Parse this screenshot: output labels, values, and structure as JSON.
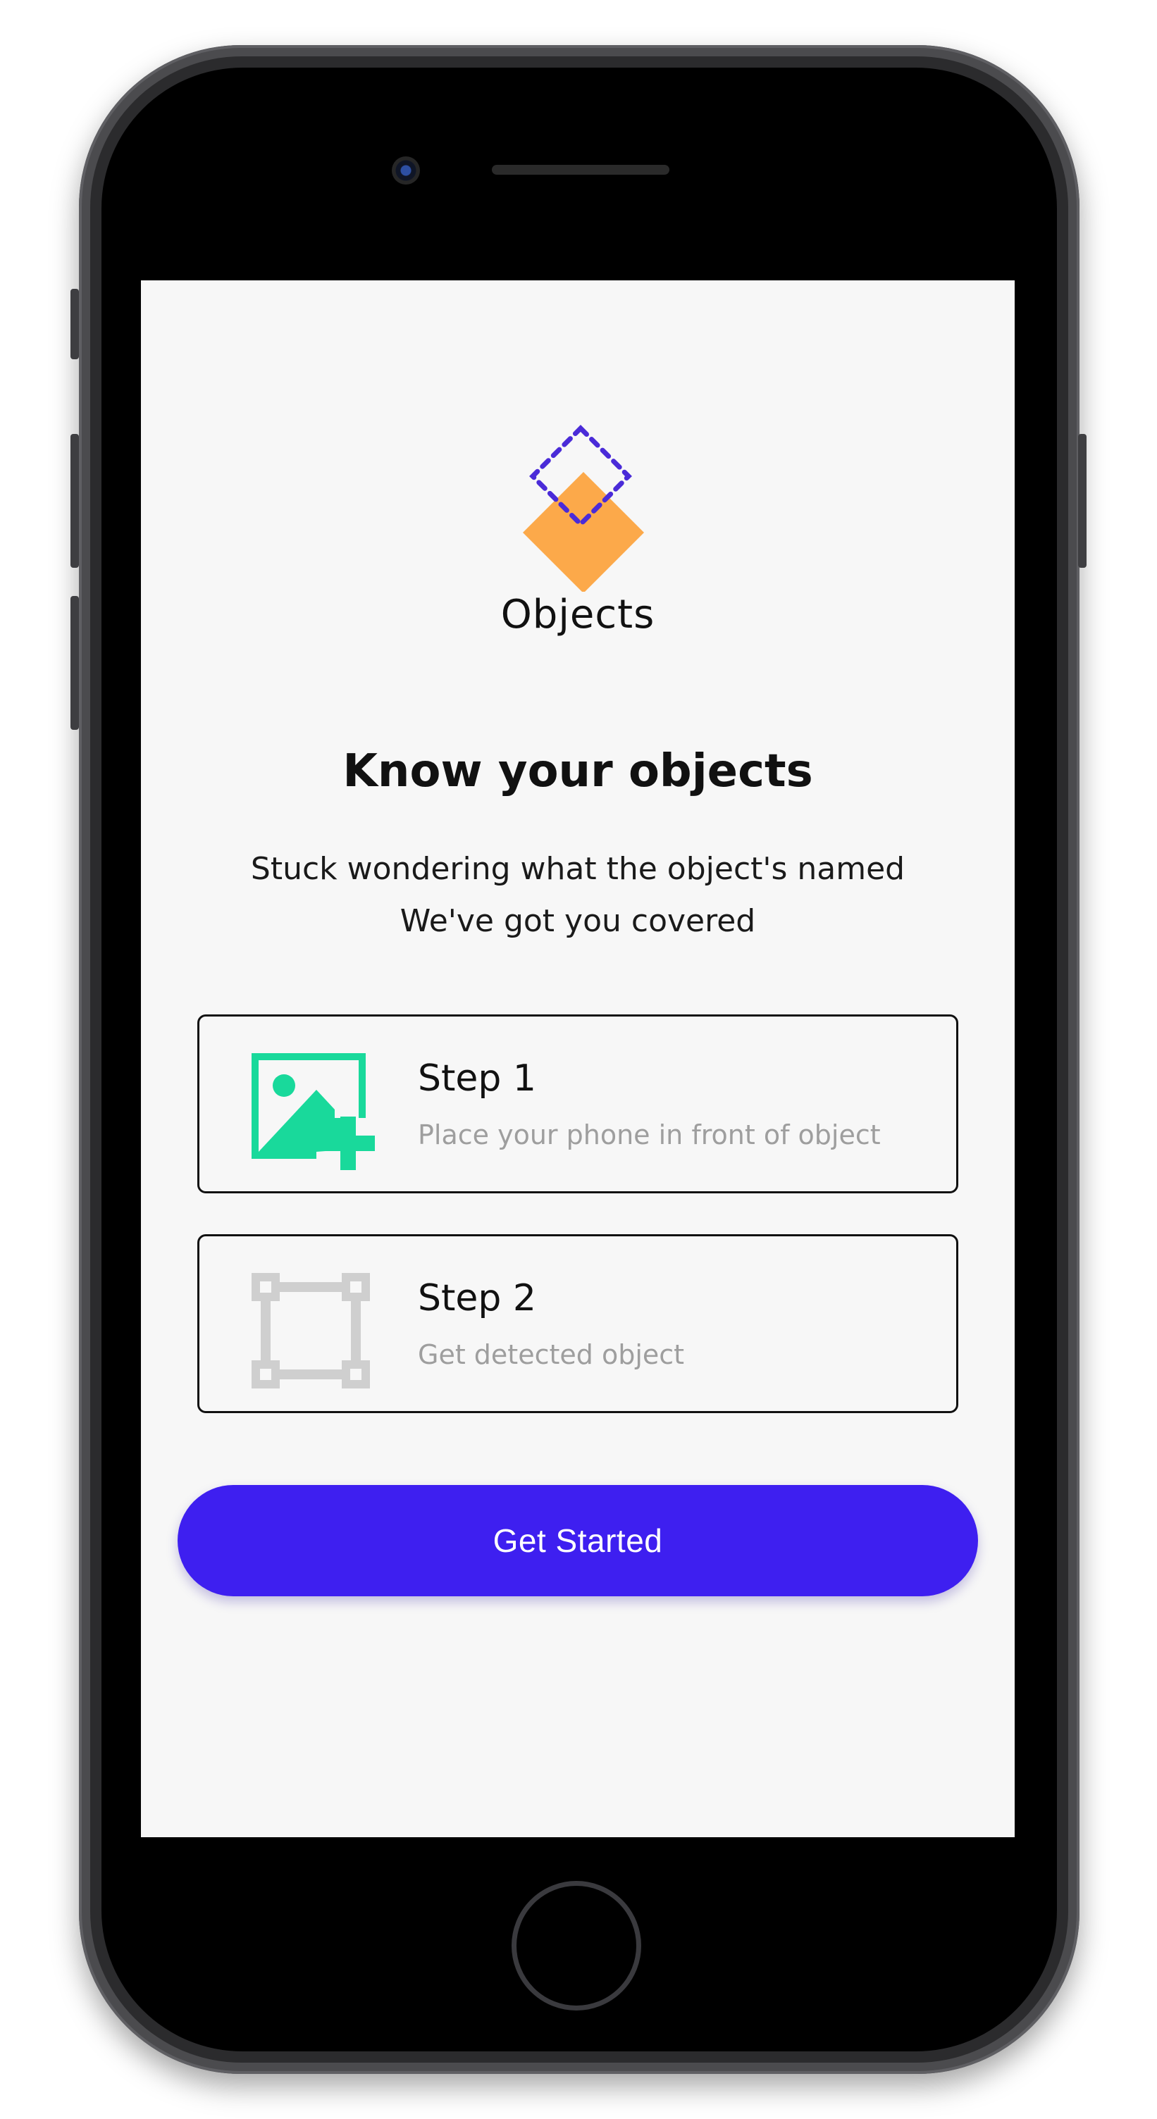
{
  "app": {
    "name": "Objects"
  },
  "onboarding": {
    "headline": "Know your objects",
    "subline_1": "Stuck wondering what the object's named",
    "subline_2": "We've got you covered"
  },
  "steps": [
    {
      "title": "Step 1",
      "description": "Place your phone in front of object",
      "icon": "add-photo-icon",
      "icon_color": "#19d99b"
    },
    {
      "title": "Step 2",
      "description": "Get detected object",
      "icon": "bounding-box-icon",
      "icon_color": "#cfcfcf"
    }
  ],
  "cta": {
    "label": "Get Started",
    "color": "#3e1ff0"
  },
  "colors": {
    "logo_orange": "#fca94a",
    "logo_purple": "#4a2bd8",
    "screen_background": "#f7f7f7"
  }
}
